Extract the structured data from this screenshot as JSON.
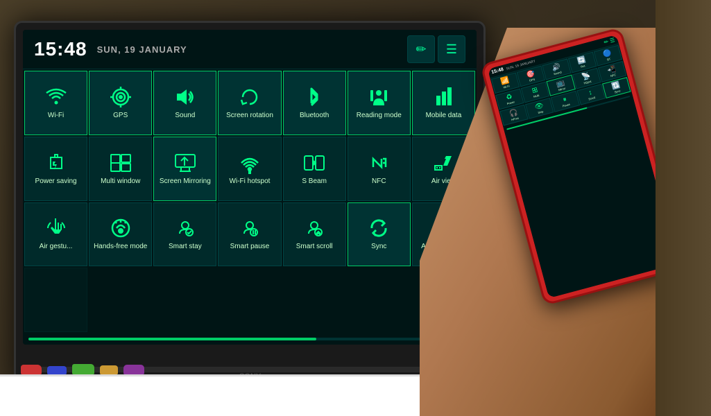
{
  "tv": {
    "time": "15:48",
    "date": "SUN, 19 JANUARY",
    "logo": "SONY"
  },
  "header": {
    "edit_icon": "✏",
    "menu_icon": "☰"
  },
  "progress": {
    "fill_percent": 65
  },
  "grid_rows": [
    [
      {
        "id": "wifi",
        "label": "Wi-Fi",
        "icon": "wifi",
        "active": true
      },
      {
        "id": "gps",
        "label": "GPS",
        "icon": "gps",
        "active": true
      },
      {
        "id": "sound",
        "label": "Sound",
        "icon": "sound",
        "active": true
      },
      {
        "id": "screen-rotation",
        "label": "Screen\nrotation",
        "icon": "rotation",
        "active": true
      },
      {
        "id": "bluetooth",
        "label": "Bluetooth",
        "icon": "bluetooth",
        "active": true
      },
      {
        "id": "reading-mode",
        "label": "Reading\nmode",
        "icon": "reading",
        "active": true
      },
      {
        "id": "mobile-data",
        "label": "Mobile\ndata",
        "icon": "mobile",
        "active": true
      }
    ],
    [
      {
        "id": "power-saving",
        "label": "Power\nsaving",
        "icon": "power",
        "active": false
      },
      {
        "id": "multi-window",
        "label": "Multi\nwindow",
        "icon": "multi",
        "active": false
      },
      {
        "id": "screen-mirroring",
        "label": "Screen\nMirroring",
        "icon": "mirror",
        "active": true
      },
      {
        "id": "wifi-hotspot",
        "label": "Wi-Fi\nhotspot",
        "icon": "hotspot",
        "active": false
      },
      {
        "id": "s-beam",
        "label": "S Beam",
        "icon": "sbeam",
        "active": false
      },
      {
        "id": "nfc",
        "label": "NFC",
        "icon": "nfc",
        "active": false
      },
      {
        "id": "air-view",
        "label": "Air\nview",
        "icon": "airview",
        "active": false
      }
    ],
    [
      {
        "id": "hands-free",
        "label": "Hands-free\nmode",
        "icon": "handsfree",
        "active": false
      },
      {
        "id": "smart-stay",
        "label": "Smart\nstay",
        "icon": "smartstay",
        "active": false
      },
      {
        "id": "smart-pause",
        "label": "Smart\npause",
        "icon": "smartpause",
        "active": false
      },
      {
        "id": "smart-scroll",
        "label": "Smart\nscroll",
        "icon": "smartscroll",
        "active": false
      },
      {
        "id": "sync",
        "label": "Sync",
        "icon": "sync",
        "active": true
      },
      {
        "id": "airplane",
        "label": "Airplane\nmode",
        "icon": "airplane",
        "active": false
      },
      {
        "id": "air-gesture",
        "label": "Air\ngestu...",
        "icon": "gesture",
        "active": false
      }
    ]
  ],
  "toys": [
    {
      "color": "#cc3333"
    },
    {
      "color": "#3333cc"
    },
    {
      "color": "#33cc33"
    },
    {
      "color": "#cccc33"
    },
    {
      "color": "#cc33cc"
    }
  ]
}
